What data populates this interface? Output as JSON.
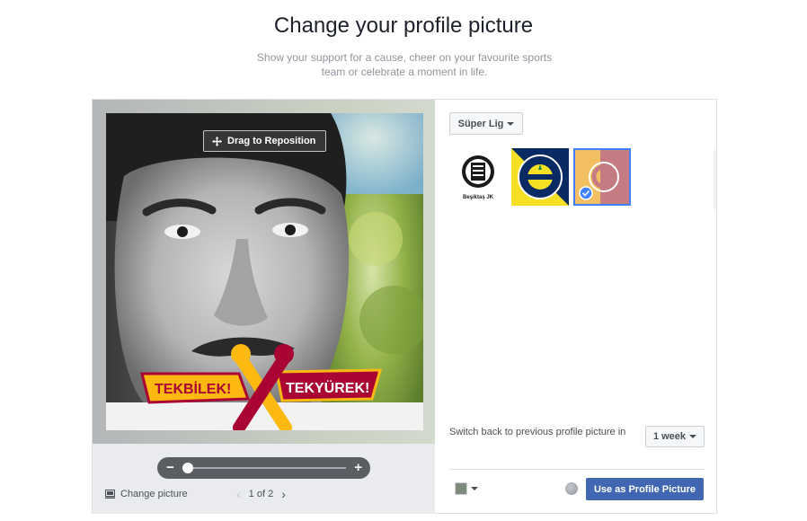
{
  "header": {
    "title": "Change your profile picture",
    "subtitle": "Show your support for a cause, cheer on your favourite sports team or celebrate a moment in life."
  },
  "editor": {
    "drag_label": "Drag to Reposition",
    "zoom_level": 0,
    "change_picture_label": "Change picture",
    "pager_text": "1 of 2",
    "frame_banner": {
      "left_text": "TEKBİLEK!",
      "right_text": "TEKYÜREK!"
    }
  },
  "sidebar": {
    "league_label": "Süper Lig",
    "logos": [
      {
        "name": "beşiktaş",
        "caption": "Beşiktaş JK",
        "selected": false
      },
      {
        "name": "fenerbahçe",
        "caption": "",
        "selected": false
      },
      {
        "name": "galatasaray",
        "caption": "",
        "selected": true
      }
    ],
    "switch_label": "Switch back to previous profile picture in",
    "duration_value": "1 week",
    "use_button_label": "Use as Profile Picture"
  },
  "colors": {
    "primary": "#4267b2",
    "selected_outline": "#4080ff",
    "galatasaray_red": "#a90432",
    "galatasaray_yellow": "#fdb912"
  },
  "icons": [
    "move-icon",
    "photo-icon",
    "chevron-left-icon",
    "chevron-right-icon",
    "caret-down-icon",
    "globe-icon",
    "check-icon"
  ]
}
